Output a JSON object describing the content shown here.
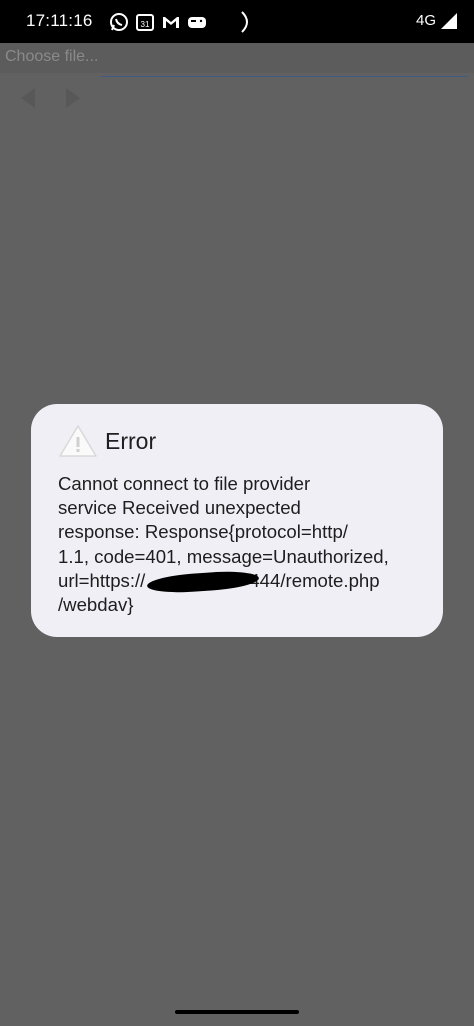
{
  "status_bar": {
    "time": "17:11:16",
    "calendar_day": "31",
    "network": "4G",
    "icons": [
      "whatsapp-icon",
      "calendar-icon",
      "gmail-icon",
      "game-controller-icon",
      "moon-icon",
      "signal-icon"
    ]
  },
  "toolbar": {
    "choose_file_label": "Choose file..."
  },
  "dialog": {
    "title": "Error",
    "message_lines": [
      "Cannot connect to file provider",
      "service  Received unexpected",
      "response: Response{protocol=http/",
      "1.1, code=401, message=Unauthorized,",
      "url=https://",
      "444/remote.php",
      "/webdav}"
    ]
  },
  "colors": {
    "background": "#616161",
    "status_bar": "#000000",
    "dialog": "#efeff5",
    "text": "#1e1e1e"
  }
}
